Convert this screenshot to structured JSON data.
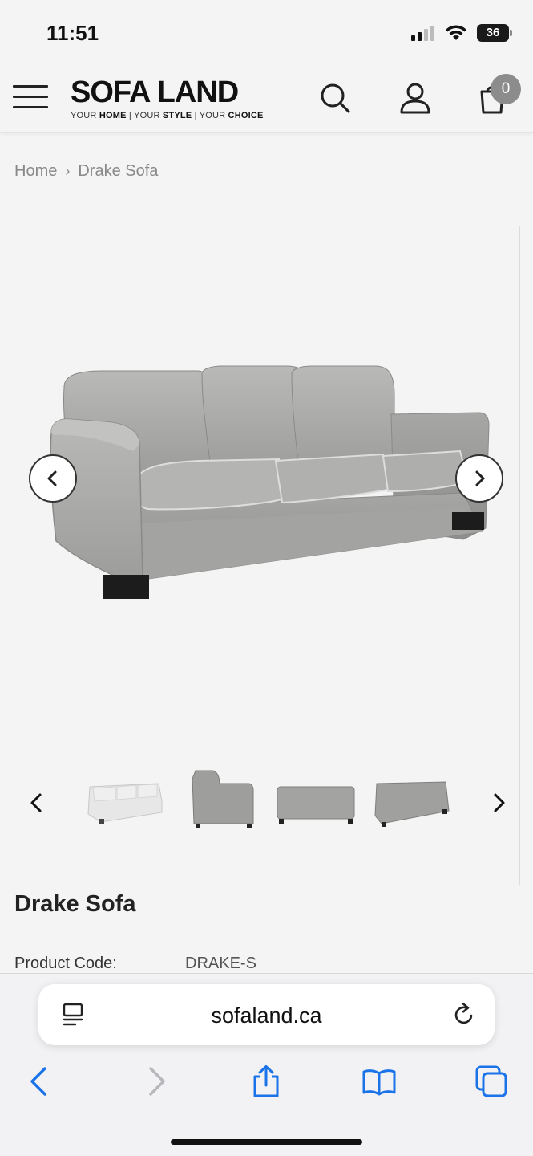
{
  "status_bar": {
    "time": "11:51",
    "battery": "36"
  },
  "header": {
    "logo_main": "SOFA LAND",
    "logo_sub_1": "YOUR ",
    "logo_sub_home": "HOME",
    "logo_sub_2": " | YOUR ",
    "logo_sub_style": "STYLE",
    "logo_sub_3": " | YOUR ",
    "logo_sub_choice": "CHOICE",
    "cart_count": "0",
    "icons": [
      "menu-icon",
      "search-icon",
      "user-icon",
      "cart-icon"
    ]
  },
  "breadcrumb": {
    "home": "Home",
    "separator": "›",
    "current": "Drake Sofa"
  },
  "gallery": {
    "main_image": "grey three-seat sofa",
    "thumbnails": [
      "light grey sofa",
      "sofa side view",
      "sofa back view",
      "sofa rear angle"
    ],
    "accent": "#333333"
  },
  "product": {
    "title": "Drake Sofa",
    "code_label": "Product Code:",
    "code_value": "DRAKE-S"
  },
  "browser": {
    "url": "sofaland.ca",
    "toolbar": [
      "back-icon",
      "forward-icon",
      "share-icon",
      "bookmarks-icon",
      "tabs-icon"
    ],
    "accent": "#1a73e8"
  }
}
